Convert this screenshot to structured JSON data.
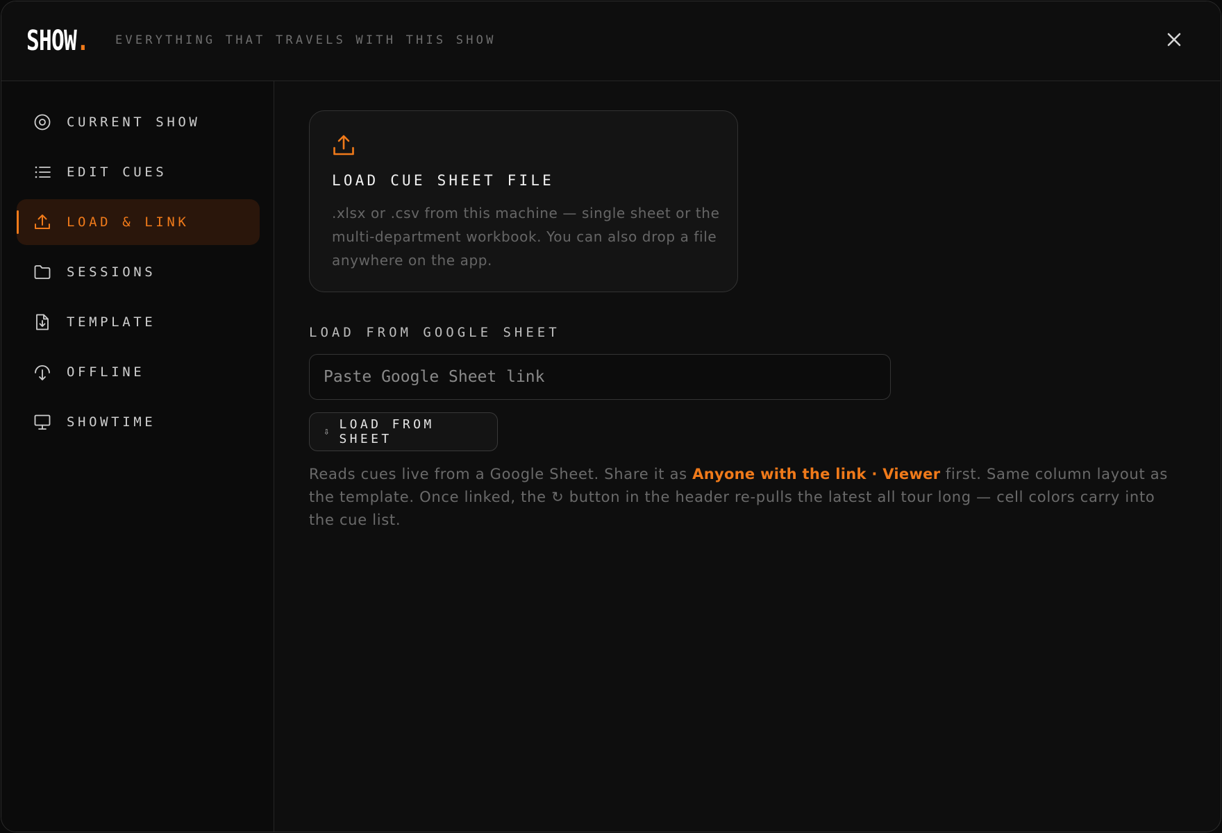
{
  "header": {
    "logo_text": "SHOW",
    "logo_dot": ".",
    "tagline": "EVERYTHING THAT TRAVELS WITH THIS SHOW",
    "close_icon": "close-icon"
  },
  "sidebar": {
    "items": [
      {
        "label": "CURRENT SHOW",
        "icon": "target-icon",
        "active": false
      },
      {
        "label": "EDIT CUES",
        "icon": "list-icon",
        "active": false
      },
      {
        "label": "LOAD & LINK",
        "icon": "upload-icon",
        "active": true
      },
      {
        "label": "SESSIONS",
        "icon": "folder-icon",
        "active": false
      },
      {
        "label": "TEMPLATE",
        "icon": "file-download-icon",
        "active": false
      },
      {
        "label": "OFFLINE",
        "icon": "cloud-download-icon",
        "active": false
      },
      {
        "label": "SHOWTIME",
        "icon": "monitor-icon",
        "active": false
      }
    ]
  },
  "main": {
    "card": {
      "icon": "upload-icon",
      "title": "LOAD CUE SHEET FILE",
      "description": ".xlsx or .csv from this machine — single sheet or the multi-department workbook. You can also drop a file anywhere on the app."
    },
    "google": {
      "label": "LOAD FROM GOOGLE SHEET",
      "placeholder": "Paste Google Sheet link",
      "value": "",
      "button_arrow": "⇩",
      "button_label": "LOAD FROM SHEET",
      "help_before": "Reads cues live from a Google Sheet. Share it as ",
      "help_highlight": "Anyone with the link · Viewer",
      "help_after": " first. Same column layout as the template. Once linked, the ↻ button in the header re-pulls the latest all tour long — cell colors carry into the cue list."
    }
  },
  "colors": {
    "accent": "#f07a1a",
    "background": "#0e0e0e",
    "active_bg": "#2a160b"
  }
}
